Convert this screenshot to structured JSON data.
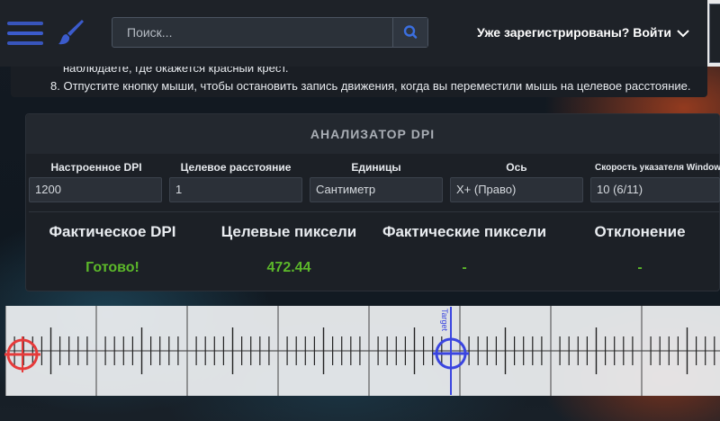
{
  "header": {
    "search_placeholder": "Поиск...",
    "login_label": "Уже зарегистрированы? Войти"
  },
  "instructions": {
    "line_1": "наблюдаете, где окажется красный крест.",
    "line_2": "8. Отпустите кнопку мыши, чтобы остановить запись движения, когда вы переместили мышь на целевое расстояние."
  },
  "analyzer": {
    "title": "АНАЛИЗАТОР DPI",
    "fields": [
      {
        "label": "Настроенное DPI",
        "value": "1200"
      },
      {
        "label": "Целевое расстояние",
        "value": "1"
      },
      {
        "label": "Единицы",
        "value": "Сантиметр"
      },
      {
        "label": "Ось",
        "value": "X+ (Право)"
      },
      {
        "label": "Скорость указателя Windows",
        "value": "10 (6/11)"
      }
    ],
    "stats": [
      {
        "label": "Фактическое DPI",
        "value": "Готово!"
      },
      {
        "label": "Целевые пиксели",
        "value": "472.44"
      },
      {
        "label": "Фактические пиксели",
        "value": "-"
      },
      {
        "label": "Отклонение",
        "value": "-"
      }
    ]
  },
  "ruler": {
    "target_label": "Target",
    "marker_colors": {
      "start": "#e63a3a",
      "target": "#3a45e0"
    }
  },
  "colors": {
    "accent": "#3b5bcc",
    "success": "#5cb82a",
    "header_bg": "#1e2228"
  }
}
